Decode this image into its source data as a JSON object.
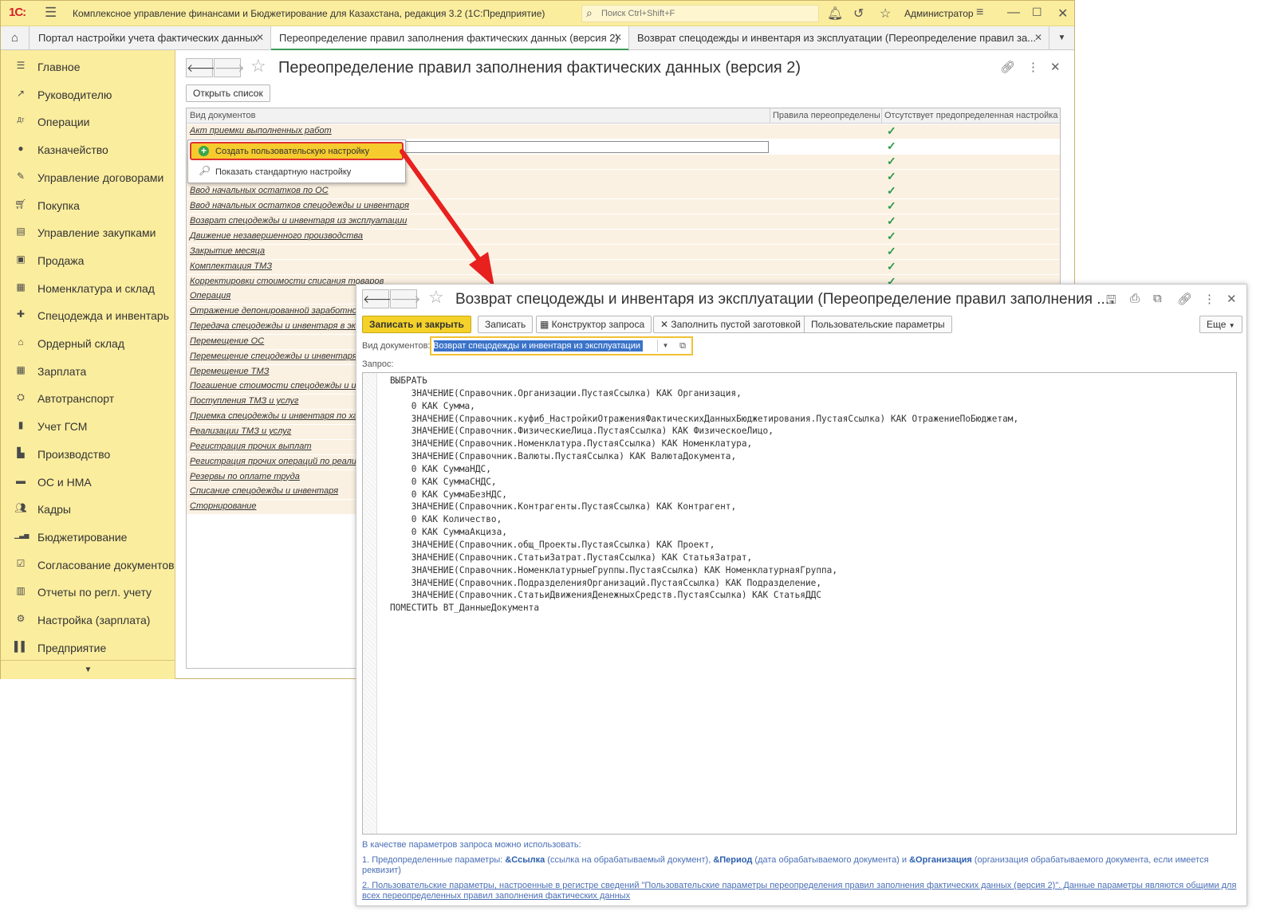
{
  "app": {
    "logo": "1С:",
    "title": "Комплексное управление финансами и Бюджетирование для Казахстана, редакция 3.2  (1С:Предприятие)",
    "search_placeholder": "Поиск Ctrl+Shift+F",
    "user": "Администратор"
  },
  "tabs": [
    {
      "label": "Портал настройки учета фактических данных"
    },
    {
      "label": "Переопределение правил заполнения фактических данных (версия 2)"
    },
    {
      "label": "Возврат спецодежды и инвентаря из эксплуатации (Переопределение правил за..."
    }
  ],
  "sidebar": {
    "items": [
      {
        "label": "Главное",
        "icon": "list-icon"
      },
      {
        "label": "Руководителю",
        "icon": "trend-icon"
      },
      {
        "label": "Операции",
        "icon": "dt-kt-icon"
      },
      {
        "label": "Казначейство",
        "icon": "coins-icon"
      },
      {
        "label": "Управление договорами",
        "icon": "contract-icon"
      },
      {
        "label": "Покупка",
        "icon": "cart-icon"
      },
      {
        "label": "Управление закупками",
        "icon": "procurement-icon"
      },
      {
        "label": "Продажа",
        "icon": "bag-icon"
      },
      {
        "label": "Номенклатура и склад",
        "icon": "grid-icon"
      },
      {
        "label": "Спецодежда и инвентарь",
        "icon": "workwear-icon"
      },
      {
        "label": "Ордерный склад",
        "icon": "warehouse-icon"
      },
      {
        "label": "Зарплата",
        "icon": "calc-icon"
      },
      {
        "label": "Автотранспорт",
        "icon": "car-icon"
      },
      {
        "label": "Учет ГСМ",
        "icon": "fuel-icon"
      },
      {
        "label": "Производство",
        "icon": "factory-icon"
      },
      {
        "label": "ОС и НМА",
        "icon": "truck-icon"
      },
      {
        "label": "Кадры",
        "icon": "people-icon"
      },
      {
        "label": "Бюджетирование",
        "icon": "chart-icon"
      },
      {
        "label": "Согласование документов",
        "icon": "approve-icon"
      },
      {
        "label": "Отчеты по регл. учету",
        "icon": "report-icon"
      },
      {
        "label": "Настройка (зарплата)",
        "icon": "settings-icon"
      },
      {
        "label": "Предприятие",
        "icon": "building-icon"
      }
    ]
  },
  "main_form": {
    "title": "Переопределение правил заполнения фактических данных (версия 2)",
    "open_list_label": "Открыть список",
    "columns": [
      "Вид документов",
      "Правила переопределены",
      "Отсутствует предопределенная настройка"
    ],
    "rows": [
      {
        "name": "Акт приемки выполненных работ",
        "missing_default": true
      },
      {
        "name": "",
        "missing_default": true,
        "editing": true
      },
      {
        "name": "",
        "missing_default": true
      },
      {
        "name": "",
        "missing_default": true
      },
      {
        "name": "Ввод начальных остатков по ОС",
        "missing_default": true
      },
      {
        "name": "Ввод начальных остатков спецодежды и инвентаря",
        "missing_default": true
      },
      {
        "name": "Возврат спецодежды и инвентаря из эксплуатации",
        "missing_default": true
      },
      {
        "name": "Движение незавершенного производства",
        "missing_default": true
      },
      {
        "name": "Закрытие месяца",
        "missing_default": true
      },
      {
        "name": "Комплектация ТМЗ",
        "missing_default": true
      },
      {
        "name": "Корректировки стоимости списания товаров",
        "missing_default": true
      },
      {
        "name": "Операция",
        "missing_default": false
      },
      {
        "name": "Отражение депонированной заработной п",
        "missing_default": false
      },
      {
        "name": "Передача спецодежды и инвентаря в экс",
        "missing_default": false
      },
      {
        "name": "Перемещение ОС",
        "missing_default": false
      },
      {
        "name": "Перемещение спецодежды и инвентаря",
        "missing_default": false
      },
      {
        "name": "Перемещение ТМЗ",
        "missing_default": false
      },
      {
        "name": "Погашение стоимости спецодежды и инв",
        "missing_default": false
      },
      {
        "name": "Поступления ТМЗ и услуг",
        "missing_default": false
      },
      {
        "name": "Приемка спецодежды и инвентаря по хар",
        "missing_default": false
      },
      {
        "name": "Реализации ТМЗ и услуг",
        "missing_default": false
      },
      {
        "name": "Регистрация прочих выплат",
        "missing_default": false
      },
      {
        "name": "Регистрация прочих операций по реализа",
        "missing_default": false
      },
      {
        "name": "Резервы по оплате труда",
        "missing_default": false
      },
      {
        "name": "Списание спецодежды и инвентаря",
        "missing_default": false
      },
      {
        "name": "Сторнирование",
        "missing_default": false
      }
    ],
    "check_glyph": "✓"
  },
  "popup_menu": {
    "create_label": "Создать пользовательскую настройку",
    "show_label": "Показать стандартную настройку"
  },
  "setting_form": {
    "title": "Возврат спецодежды и инвентаря из эксплуатации (Переопределение правил заполнения ...",
    "buttons": {
      "save_close": "Записать и закрыть",
      "save": "Записать",
      "constructor": "Конструктор запроса",
      "fill_template": "Заполнить пустой заготовкой",
      "user_params": "Пользовательские параметры",
      "more": "Еще"
    },
    "doc_type_label": "Вид документов:",
    "doc_type_value": "Возврат спецодежды и инвентаря из эксплуатации",
    "query_label": "Запрос:",
    "query_text": "ВЫБРАТЬ\n    ЗНАЧЕНИЕ(Справочник.Организации.ПустаяСсылка) КАК Организация,\n    0 КАК Сумма,\n    ЗНАЧЕНИЕ(Справочник.куфиб_НастройкиОтраженияФактическихДанныхБюджетирования.ПустаяСсылка) КАК ОтражениеПоБюджетам,\n    ЗНАЧЕНИЕ(Справочник.ФизическиеЛица.ПустаяСсылка) КАК ФизическоеЛицо,\n    ЗНАЧЕНИЕ(Справочник.Номенклатура.ПустаяСсылка) КАК Номенклатура,\n    ЗНАЧЕНИЕ(Справочник.Валюты.ПустаяСсылка) КАК ВалютаДокумента,\n    0 КАК СуммаНДС,\n    0 КАК СуммаСНДС,\n    0 КАК СуммаБезНДС,\n    ЗНАЧЕНИЕ(Справочник.Контрагенты.ПустаяСсылка) КАК Контрагент,\n    0 КАК Количество,\n    0 КАК СуммаАкциза,\n    ЗНАЧЕНИЕ(Справочник.общ_Проекты.ПустаяСсылка) КАК Проект,\n    ЗНАЧЕНИЕ(Справочник.СтатьиЗатрат.ПустаяСсылка) КАК СтатьяЗатрат,\n    ЗНАЧЕНИЕ(Справочник.НоменклатурныеГруппы.ПустаяСсылка) КАК НоменклатурнаяГруппа,\n    ЗНАЧЕНИЕ(Справочник.ПодразделенияОрганизаций.ПустаяСсылка) КАК Подразделение,\n    ЗНАЧЕНИЕ(Справочник.СтатьиДвиженияДенежныхСредств.ПустаяСсылка) КАК СтатьяДДС\nПОМЕСТИТЬ ВТ_ДанныеДокумента",
    "footer": {
      "intro": "В качестве параметров запроса можно использовать:",
      "p1_a": "1. Предопределенные параметры: ",
      "p1_ref": "&Ссылка",
      "p1_b": " (ссылка на обрабатываемый документ), ",
      "p1_period": "&Период",
      "p1_c": " (дата обрабатываемого документа) и ",
      "p1_org": "&Организация",
      "p1_d": " (организация обрабатываемого документа, если имеется",
      "p1_e": "реквизит)",
      "p2_line1": "2. Пользовательские параметры, настроенные в регистре сведений \"Пользовательские параметры переопределения правил заполнения фактических данных (версия 2)\". Данные параметры являются общими для",
      "p2_line2": "всех переопределенных правил заполнения фактических данных"
    }
  },
  "colors": {
    "accent_yellow": "#fbed9e",
    "active_tab_line": "#3a9b57",
    "row_highlight": "#fbf1e2",
    "arrow_red": "#e8201e",
    "check_green": "#2a9a4b"
  }
}
